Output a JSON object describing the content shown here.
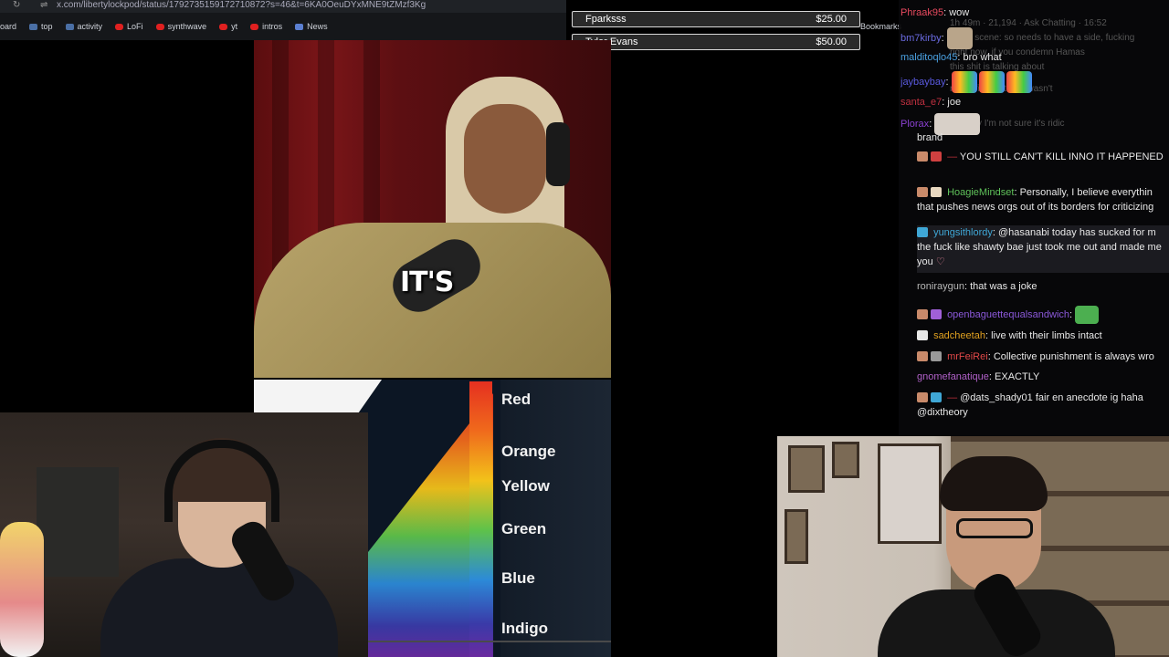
{
  "browser": {
    "url": "x.com/libertylockpod/status/1792735159172710872?s=46&t=6KA0OeuDYxMNE9tZMzf3Kg",
    "bookmarks": [
      {
        "label": "oard",
        "icon": "none-icon"
      },
      {
        "label": "top",
        "icon": "doc-icon"
      },
      {
        "label": "activity",
        "icon": "doc-icon"
      },
      {
        "label": "LoFi",
        "icon": "youtube-icon"
      },
      {
        "label": "synthwave",
        "icon": "youtube-icon"
      },
      {
        "label": "yt",
        "icon": "youtube-icon"
      },
      {
        "label": "intros",
        "icon": "youtube-icon"
      },
      {
        "label": "News",
        "icon": "news-icon"
      }
    ],
    "bookmarks_overflow": "Bookmarks"
  },
  "donations": [
    {
      "name": "Fparksss",
      "amount": "$25.00"
    },
    {
      "name": "Tyler Evans",
      "amount": "$50.00"
    }
  ],
  "clip": {
    "caption": "IT'S"
  },
  "spectrum": {
    "labels": [
      "Red",
      "Orange",
      "Yellow",
      "Green",
      "Blue",
      "Indigo"
    ]
  },
  "chat": {
    "pinned": [
      {
        "user": "Phraak95",
        "text": "wow",
        "user_color": "#e84a5f"
      },
      {
        "user": "bm7kirby",
        "text": "",
        "user_color": "#6a6ae0",
        "emote": true
      },
      {
        "user": "malditoqlo45",
        "text": "bro what",
        "user_color": "#4aa0e0"
      },
      {
        "user": "jaybaybay",
        "text": "",
        "user_color": "#5a5ae0",
        "emote": true
      },
      {
        "user": "santa_e7",
        "text": "joe",
        "user_color": "#c03040"
      },
      {
        "user": "Plorax",
        "text": "",
        "user_color": "#8a40d0",
        "emote": true
      }
    ],
    "messages": [
      {
        "user": "",
        "text": "brand",
        "user_color": "#aaa"
      },
      {
        "user": "—",
        "text": "YOU STILL CAN'T KILL INNO IT HAPPENED",
        "user_color": "#c0303a"
      },
      {
        "user": "HoagieMindset",
        "text": "Personally, I believe everythin that pushes news orgs out of its borders for criticizing",
        "user_color": "#5fc25a"
      },
      {
        "user": "yungsithlordy",
        "text": "@hasanabi today has sucked for m the fuck like shawty bae just took me out and made me you",
        "user_color": "#3fa7d6"
      },
      {
        "user": "roniraygun",
        "text": "that was a joke",
        "user_color": "#b8b8b8"
      },
      {
        "user": "openbaguettequalsandwich",
        "text": "",
        "user_color": "#8a58d8"
      },
      {
        "user": "sadcheetah",
        "text": "live with their limbs intact",
        "user_color": "#e0a020"
      },
      {
        "user": "mrFeiRei",
        "text": "Collective punishment is always wro",
        "user_color": "#e04848"
      },
      {
        "user": "gnomefanatique",
        "text": "EXACTLY",
        "user_color": "#b060c8"
      },
      {
        "user": "—",
        "text": "@dats_shady01 fair en anecdote ig haha @dixtheory",
        "user_color": "#c0303a"
      }
    ]
  },
  "colors": {
    "background": "#000000",
    "chat_bg": "#08080a",
    "accent_red": "#c0303a"
  }
}
